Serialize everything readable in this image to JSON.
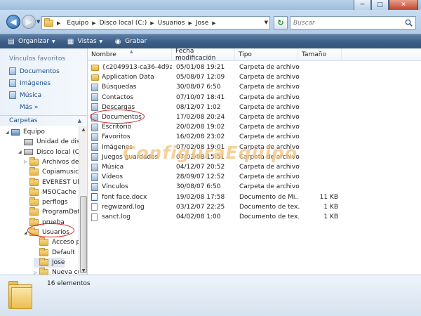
{
  "window": {
    "minimize_glyph": "─",
    "maximize_glyph": "□",
    "close_glyph": "✕"
  },
  "address": {
    "crumbs": [
      "Equipo",
      "Disco local (C:)",
      "Usuarios",
      "Jose"
    ]
  },
  "search": {
    "placeholder": "Buscar"
  },
  "toolbar": {
    "organize_label": "Organizar",
    "views_label": "Vistas",
    "burn_label": "Grabar"
  },
  "favorites": {
    "heading": "Vínculos favoritos",
    "items": [
      {
        "label": "Documentos",
        "icon": "documents-icon"
      },
      {
        "label": "Imágenes",
        "icon": "pictures-icon"
      },
      {
        "label": "Música",
        "icon": "music-icon"
      }
    ],
    "more_label": "Más",
    "more_glyph": "»"
  },
  "folders": {
    "heading": "Carpetas",
    "tree": [
      {
        "label": "Equipo",
        "kind": "computer"
      },
      {
        "label": "Unidad de disc",
        "kind": "drive"
      },
      {
        "label": "Disco local (C:",
        "kind": "disk"
      },
      {
        "label": "Archivos de p",
        "kind": "folder"
      },
      {
        "label": "Copiamusica",
        "kind": "folder"
      },
      {
        "label": "EVEREST Ulti",
        "kind": "folder"
      },
      {
        "label": "MSOCache",
        "kind": "folder"
      },
      {
        "label": "perflogs",
        "kind": "folder"
      },
      {
        "label": "ProgramData",
        "kind": "folder"
      },
      {
        "label": "prueba",
        "kind": "folder"
      },
      {
        "label": "Usuarios",
        "kind": "folder"
      },
      {
        "label": "Acceso púl",
        "kind": "folder"
      },
      {
        "label": "Default",
        "kind": "folder"
      },
      {
        "label": "Jose",
        "kind": "folder"
      },
      {
        "label": "Nueva cue",
        "kind": "folder"
      }
    ]
  },
  "columns": {
    "name": "Nombre",
    "date": "Fecha modificación",
    "type": "Tipo",
    "size": "Tamaño"
  },
  "files": [
    {
      "name": "{c2049913-ca36-4d9a-...",
      "date": "05/01/08 19:21",
      "type": "Carpeta de archivos",
      "size": "",
      "icon": "folder"
    },
    {
      "name": "Application Data",
      "date": "05/08/07 12:09",
      "type": "Carpeta de archivos",
      "size": "",
      "icon": "folder"
    },
    {
      "name": "Búsquedas",
      "date": "30/08/07 6:50",
      "type": "Carpeta de archivos",
      "size": "",
      "icon": "special"
    },
    {
      "name": "Contactos",
      "date": "07/10/07 18:41",
      "type": "Carpeta de archivos",
      "size": "",
      "icon": "special"
    },
    {
      "name": "Descargas",
      "date": "08/12/07 1:02",
      "type": "Carpeta de archivos",
      "size": "",
      "icon": "special"
    },
    {
      "name": "Documentos",
      "date": "17/02/08 20:24",
      "type": "Carpeta de archivos",
      "size": "",
      "icon": "special"
    },
    {
      "name": "Escritorio",
      "date": "20/02/08 19:02",
      "type": "Carpeta de archivos",
      "size": "",
      "icon": "special"
    },
    {
      "name": "Favoritos",
      "date": "16/02/08 23:02",
      "type": "Carpeta de archivos",
      "size": "",
      "icon": "special"
    },
    {
      "name": "Imágenes",
      "date": "07/02/08 19:01",
      "type": "Carpeta de archivos",
      "size": "",
      "icon": "special"
    },
    {
      "name": "Juegos guardados",
      "date": "07/02/08 15:51",
      "type": "Carpeta de archivos",
      "size": "",
      "icon": "special"
    },
    {
      "name": "Música",
      "date": "04/12/07 20:52",
      "type": "Carpeta de archivos",
      "size": "",
      "icon": "special"
    },
    {
      "name": "Vídeos",
      "date": "28/09/07 12:52",
      "type": "Carpeta de archivos",
      "size": "",
      "icon": "special"
    },
    {
      "name": "Vínculos",
      "date": "30/08/07 6:50",
      "type": "Carpeta de archivos",
      "size": "",
      "icon": "special"
    },
    {
      "name": "font face.docx",
      "date": "19/02/08 17:58",
      "type": "Documento de Mi...",
      "size": "11 KB",
      "icon": "doc"
    },
    {
      "name": "regwizard.log",
      "date": "03/12/07 22:25",
      "type": "Documento de tex...",
      "size": "1 KB",
      "icon": "file"
    },
    {
      "name": "sanct.log",
      "date": "04/02/08 1:00",
      "type": "Documento de tex...",
      "size": "1 KB",
      "icon": "file"
    }
  ],
  "watermark": "ConfiguraEquipo",
  "status": {
    "count_text": "16 elementos"
  },
  "colors": {
    "highlight_ring": "#c91e1e",
    "link": "#1b4f86"
  }
}
